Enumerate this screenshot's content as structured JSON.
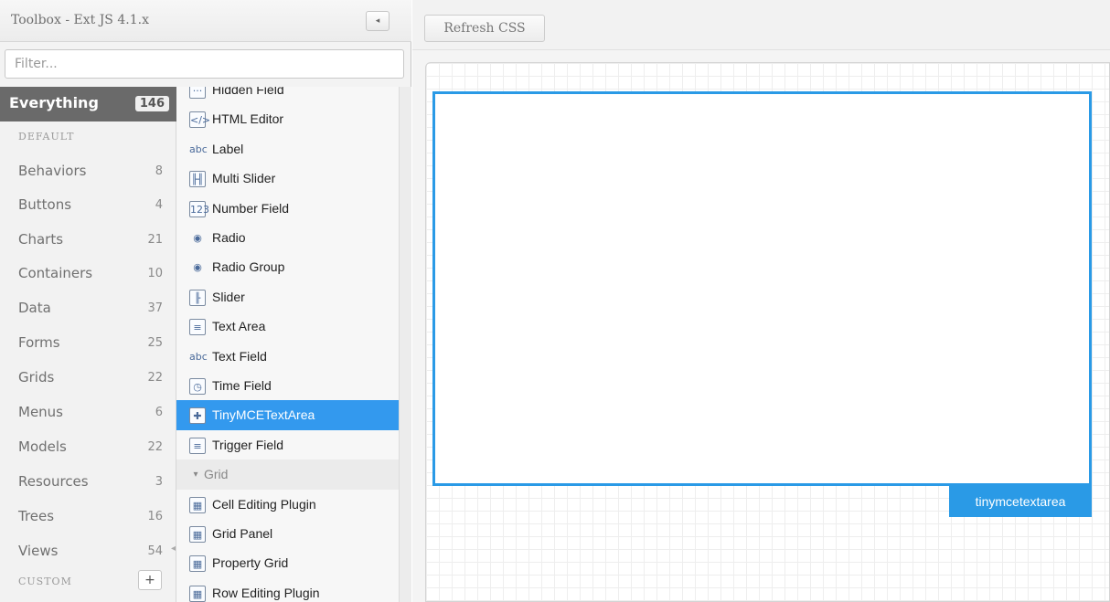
{
  "toolbox": {
    "title": "Toolbox - Ext JS 4.1.x",
    "collapse_glyph": "◂",
    "filter_placeholder": "Filter..."
  },
  "categories": {
    "everything": {
      "label": "Everything",
      "count": "146"
    },
    "default_section": "DEFAULT",
    "items": [
      {
        "label": "Behaviors",
        "count": "8"
      },
      {
        "label": "Buttons",
        "count": "4"
      },
      {
        "label": "Charts",
        "count": "21"
      },
      {
        "label": "Containers",
        "count": "10"
      },
      {
        "label": "Data",
        "count": "37"
      },
      {
        "label": "Forms",
        "count": "25"
      },
      {
        "label": "Grids",
        "count": "22"
      },
      {
        "label": "Menus",
        "count": "6"
      },
      {
        "label": "Models",
        "count": "22"
      },
      {
        "label": "Resources",
        "count": "3"
      },
      {
        "label": "Trees",
        "count": "16"
      },
      {
        "label": "Views",
        "count": "54"
      }
    ],
    "custom_section": "CUSTOM",
    "custom_add_glyph": "+"
  },
  "components": [
    {
      "label": "Hidden Field",
      "icon": "hidden-field-icon",
      "glyph": "···"
    },
    {
      "label": "HTML Editor",
      "icon": "html-editor-icon",
      "glyph": "</>"
    },
    {
      "label": "Label",
      "icon": "label-icon",
      "glyph": "abc"
    },
    {
      "label": "Multi Slider",
      "icon": "multi-slider-icon",
      "glyph": "╟╢"
    },
    {
      "label": "Number Field",
      "icon": "number-field-icon",
      "glyph": "123"
    },
    {
      "label": "Radio",
      "icon": "radio-icon",
      "glyph": "◉"
    },
    {
      "label": "Radio Group",
      "icon": "radio-group-icon",
      "glyph": "◉"
    },
    {
      "label": "Slider",
      "icon": "slider-icon",
      "glyph": "╟"
    },
    {
      "label": "Text Area",
      "icon": "text-area-icon",
      "glyph": "≡"
    },
    {
      "label": "Text Field",
      "icon": "text-field-icon",
      "glyph": "abc"
    },
    {
      "label": "Time Field",
      "icon": "time-field-icon",
      "glyph": "◷"
    },
    {
      "label": "TinyMCETextArea",
      "icon": "plugin-icon",
      "glyph": "✚",
      "selected": true
    },
    {
      "label": "Trigger Field",
      "icon": "trigger-field-icon",
      "glyph": "≡"
    },
    {
      "label": "Grid",
      "icon": "collapse-triangle-icon",
      "glyph": "▾",
      "group": true
    },
    {
      "label": "Cell Editing Plugin",
      "icon": "cell-editing-icon",
      "glyph": "▦"
    },
    {
      "label": "Grid Panel",
      "icon": "grid-panel-icon",
      "glyph": "▦"
    },
    {
      "label": "Property Grid",
      "icon": "property-grid-icon",
      "glyph": "▦"
    },
    {
      "label": "Row Editing Plugin",
      "icon": "row-editing-icon",
      "glyph": "▦"
    }
  ],
  "canvas": {
    "refresh_label": "Refresh CSS",
    "component_tag": "tinymcetextarea"
  },
  "colors": {
    "selection": "#3399ee",
    "component_border": "#2a9ae6",
    "everything_bg": "#6a6a6a"
  }
}
